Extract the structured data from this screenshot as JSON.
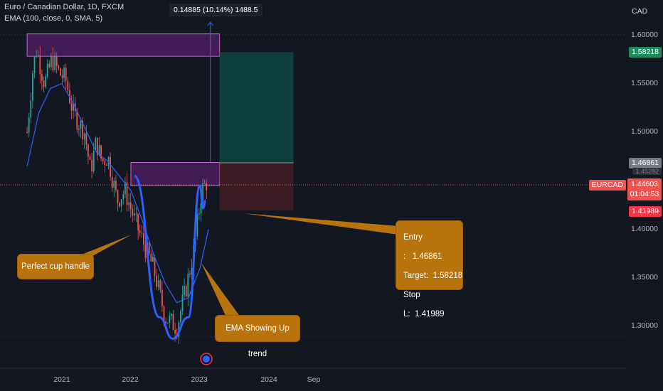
{
  "header": {
    "symbol_line": "Euro / Canadian Dollar, 1D, FXCM",
    "indicator_line": "EMA (100, close, 0, SMA, 5)",
    "currency": "CAD"
  },
  "measure_label": "0.14885 (10.14%) 1488.5",
  "price_tags": {
    "target": "1.58218",
    "entry": "1.46861",
    "symbol": "EURCAD",
    "current": "1.44603",
    "countdown": "01:04:53",
    "stop": "1.41989",
    "hidden_partial": "1.45282"
  },
  "callouts": {
    "cup": "Perfect cup handle",
    "ema": "EMA Showing Up trend",
    "trade": [
      {
        "label": "Entry :",
        "value": "1.46861"
      },
      {
        "label": "Target:",
        "value": "1.58218"
      },
      {
        "label": "Stop L:",
        "value": "1.41989"
      }
    ]
  },
  "colors": {
    "background": "#131722",
    "candle_up": "#26a69a",
    "candle_down": "#ef5350",
    "ema": "#2962ff",
    "cup_line": "#2962ff",
    "zone": "#9c27b0",
    "target_zone": "#0e4c47",
    "stop_zone": "#4b1f26",
    "callout": "#b8730c"
  },
  "chart_data": {
    "type": "candlestick",
    "x_axis": {
      "ticks": [
        "2021",
        "2022",
        "2023",
        "2024",
        "Sep"
      ]
    },
    "y_axis": {
      "ticks": [
        "1.60000",
        "1.55000",
        "1.50000",
        "1.40000",
        "1.35000",
        "1.30000"
      ],
      "range": [
        1.26,
        1.63
      ],
      "side": "right"
    },
    "close_path": [
      [
        "2020-07-01",
        1.5
      ],
      [
        "2020-08-01",
        1.566
      ],
      [
        "2020-08-20",
        1.585
      ],
      [
        "2020-10-01",
        1.55
      ],
      [
        "2020-11-10",
        1.575
      ],
      [
        "2020-12-20",
        1.56
      ],
      [
        "2021-01-20",
        1.555
      ],
      [
        "2021-03-01",
        1.52
      ],
      [
        "2021-05-01",
        1.5
      ],
      [
        "2021-06-01",
        1.46
      ],
      [
        "2021-07-01",
        1.49
      ],
      [
        "2021-08-01",
        1.47
      ],
      [
        "2021-09-01",
        1.475
      ],
      [
        "2021-10-20",
        1.43
      ],
      [
        "2021-12-01",
        1.44
      ],
      [
        "2022-01-20",
        1.41
      ],
      [
        "2022-03-01",
        1.39
      ],
      [
        "2022-05-01",
        1.36
      ],
      [
        "2022-07-01",
        1.31
      ],
      [
        "2022-09-01",
        1.3
      ],
      [
        "2022-10-20",
        1.34
      ],
      [
        "2022-12-01",
        1.38
      ],
      [
        "2023-01-10",
        1.44
      ],
      [
        "2023-02-10",
        1.45
      ]
    ],
    "ema_path": [
      [
        "2020-07-01",
        1.465
      ],
      [
        "2020-09-01",
        1.52
      ],
      [
        "2020-11-01",
        1.545
      ],
      [
        "2021-01-01",
        1.55
      ],
      [
        "2021-03-01",
        1.53
      ],
      [
        "2021-05-01",
        1.505
      ],
      [
        "2021-07-01",
        1.48
      ],
      [
        "2021-09-01",
        1.47
      ],
      [
        "2021-11-01",
        1.455
      ],
      [
        "2022-01-01",
        1.44
      ],
      [
        "2022-03-01",
        1.41
      ],
      [
        "2022-05-01",
        1.375
      ],
      [
        "2022-07-01",
        1.345
      ],
      [
        "2022-09-01",
        1.325
      ],
      [
        "2022-11-01",
        1.33
      ],
      [
        "2023-01-01",
        1.36
      ],
      [
        "2023-02-15",
        1.4
      ]
    ],
    "cup_curve": [
      [
        "2022-01-20",
        1.455
      ],
      [
        "2022-06-01",
        1.31
      ],
      [
        "2022-08-10",
        1.288
      ],
      [
        "2022-11-01",
        1.31
      ],
      [
        "2023-01-01",
        1.445
      ],
      [
        "2023-01-18",
        1.422
      ],
      [
        "2023-02-01",
        1.43
      ]
    ],
    "zones": [
      {
        "name": "top-resistance",
        "from": "2020-07-01",
        "to": "2023-04-15",
        "low": 1.578,
        "high": 1.601
      },
      {
        "name": "neckline",
        "from": "2022-01-01",
        "to": "2023-04-15",
        "low": 1.445,
        "high": 1.469
      }
    ],
    "position": {
      "from": "2023-04-15",
      "to": "2024-05-10",
      "entry": 1.46861,
      "target": 1.58218,
      "stop": 1.41989
    },
    "current_price": 1.44603,
    "measure": {
      "date": "2023-02-25",
      "from": 1.469,
      "to": 1.613
    }
  }
}
